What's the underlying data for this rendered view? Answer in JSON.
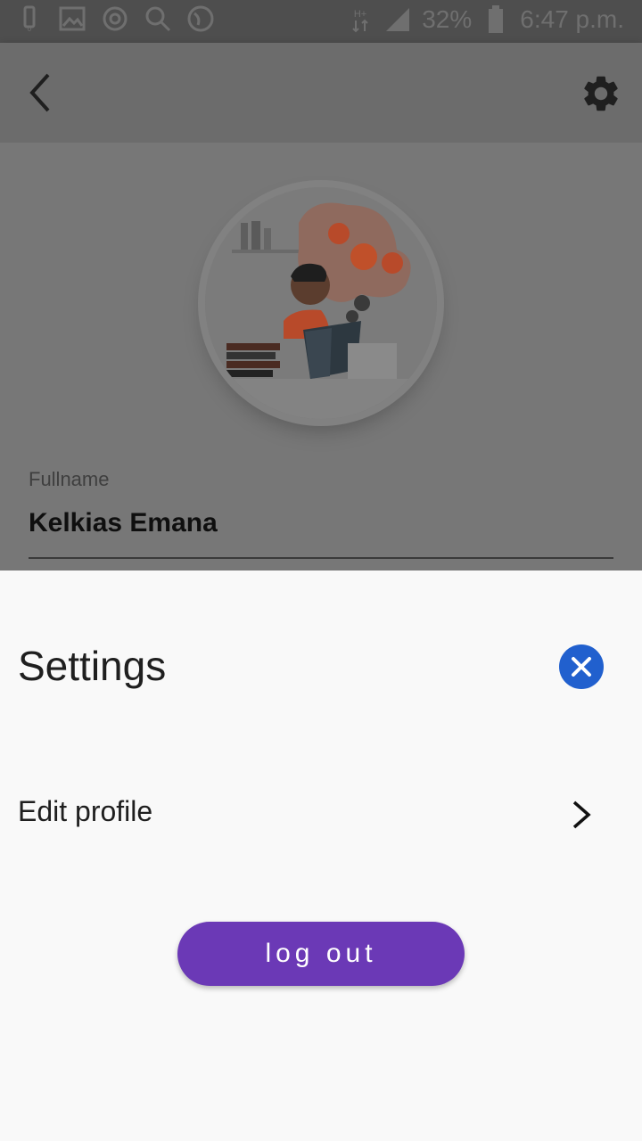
{
  "status_bar": {
    "battery": "32%",
    "time": "6:47 p.m.",
    "icons": [
      "data-icon",
      "gallery-icon",
      "target-icon",
      "search-icon",
      "globe-icon",
      "hplus-network-icon",
      "signal-icon",
      "battery-icon"
    ]
  },
  "app_bar": {
    "back_icon": "chevron-left-icon",
    "settings_icon": "gear-icon"
  },
  "profile": {
    "avatar": "illustration-reading-student",
    "field_label": "Fullname",
    "field_value": "Kelkias Emana"
  },
  "sheet": {
    "title": "Settings",
    "close_icon": "close-icon",
    "items": [
      {
        "label": "Edit profile",
        "icon": "chevron-right-icon"
      }
    ],
    "logout_label": "log out"
  },
  "colors": {
    "accent_blue": "#2160ce",
    "logout_purple": "#6b39b6",
    "sheet_bg": "#f9f9f9",
    "overlay_dim": "#777777"
  }
}
